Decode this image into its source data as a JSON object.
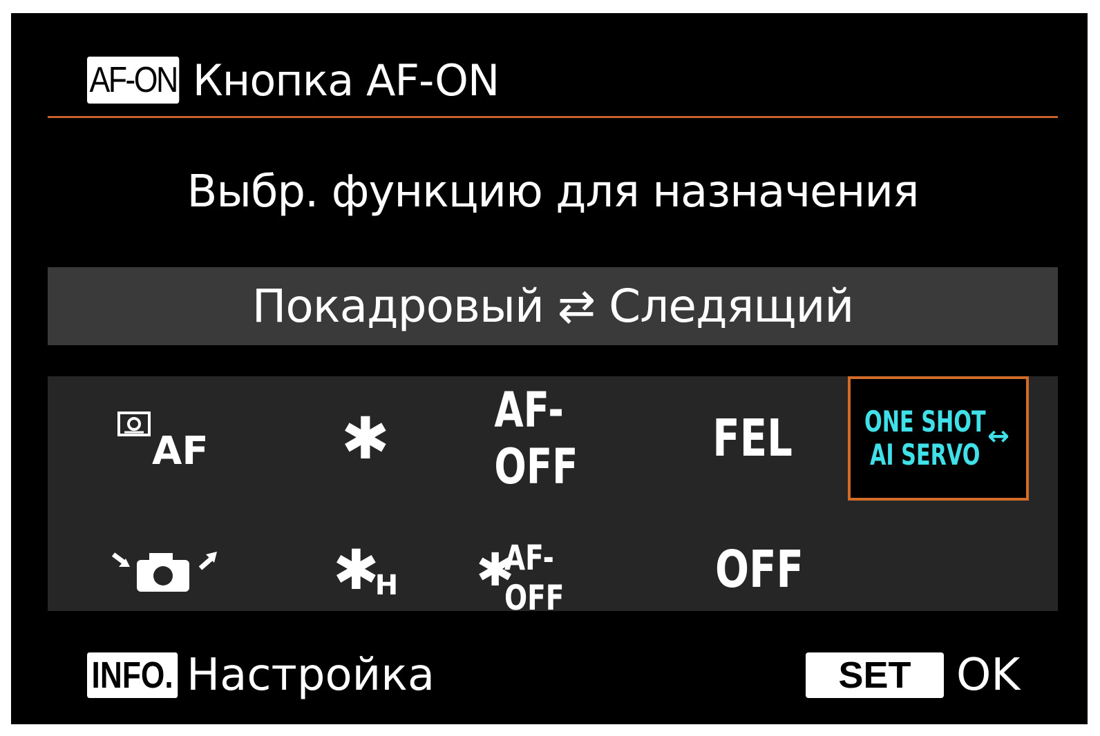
{
  "header": {
    "badge": "AF-ON",
    "title": "Кнопка AF-ON"
  },
  "prompt": "Выбр. функцию для назначения",
  "selected_function_name": "Покадровый ⇄ Следящий",
  "functions": {
    "row1": {
      "metering_af": {
        "icon": "metering-af-icon",
        "label": "AF"
      },
      "ae_lock": {
        "icon": "ae-lock-asterisk-icon",
        "label": "✱"
      },
      "af_off": {
        "label": "AF-OFF"
      },
      "fel": {
        "label": "FEL"
      },
      "one_shot_ai_servo": {
        "line1": "ONE SHOT",
        "line2": "AI SERVO",
        "arrow": "↔"
      }
    },
    "row2": {
      "capture_mode": {
        "icon": "camera-capture-mode-icon"
      },
      "ae_lock_hold": {
        "label": "✱",
        "sub": "H"
      },
      "ae_lock_af_off": {
        "label": "✱",
        "sub": "AF-OFF"
      },
      "off": {
        "label": "OFF"
      }
    }
  },
  "footer": {
    "info_badge": "INFO.",
    "info_label": "Настройка",
    "set_badge": "SET",
    "set_label": "OK"
  },
  "colors": {
    "accent": "#d26a28",
    "selected_text": "#3fe0e8",
    "name_bar": "#3a3a3a",
    "grid_bg": "#262626"
  }
}
